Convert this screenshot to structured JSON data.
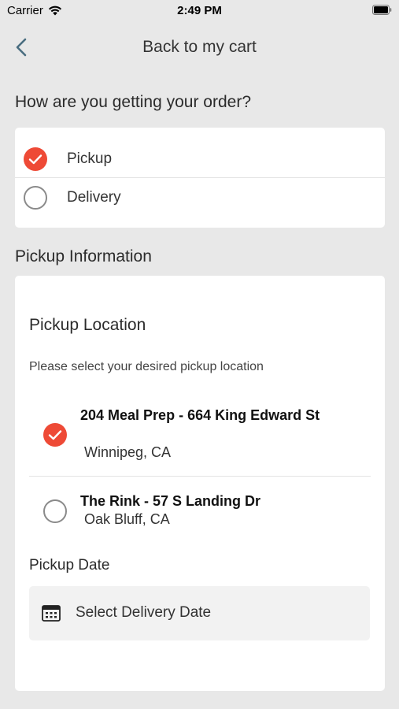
{
  "status_bar": {
    "carrier": "Carrier",
    "time": "2:49 PM"
  },
  "nav": {
    "back_icon": "chevron-left-icon",
    "title": "Back to my cart"
  },
  "order_method": {
    "heading": "How are you getting your order?",
    "options": [
      {
        "label": "Pickup",
        "selected": true
      },
      {
        "label": "Delivery",
        "selected": false
      }
    ]
  },
  "pickup_info": {
    "heading": "Pickup Information",
    "location_heading": "Pickup Location",
    "location_help": "Please select your desired pickup location",
    "locations": [
      {
        "name": "204 Meal Prep - 664 King Edward St",
        "city": "Winnipeg, CA",
        "selected": true
      },
      {
        "name": "The Rink - 57 S Landing Dr",
        "city": "Oak Bluff, CA",
        "selected": false
      }
    ],
    "date_heading": "Pickup Date",
    "date_placeholder": "Select Delivery Date",
    "date_icon": "calendar-icon"
  },
  "colors": {
    "accent": "#ee4a36",
    "background": "#e8e8e8",
    "card": "#ffffff",
    "date_field": "#f2f2f2"
  }
}
